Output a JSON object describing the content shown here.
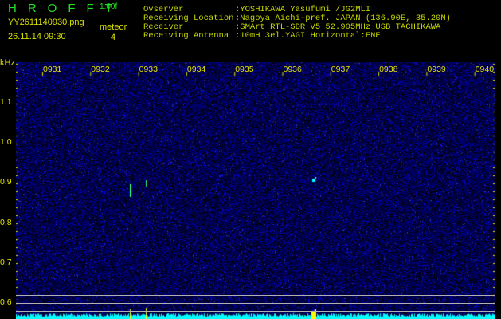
{
  "header": {
    "app": "HROFFT",
    "version": "1.00f",
    "filename": "YY2611140930.png",
    "datetime": "26.11.14 09:30",
    "meteor_label": "meteor",
    "meteor_count": "4"
  },
  "info": {
    "observer_label": "Ovserver",
    "observer": ":YOSHIKAWA Yasufumi /JG2MLI",
    "location_label": "Receiving Location",
    "location": ":Nagoya Aichi-pref. JAPAN (136.90E, 35.20N)",
    "receiver_label": "Receiver",
    "receiver": ":SMArt RTL-SDR V5 52.905MHz USB TACHIKAWA",
    "antenna_label": "Receiving Antenna",
    "antenna": ":10mH 3el.YAGI Horizontal:ENE"
  },
  "axis": {
    "unit": "kHz",
    "freq_ticks": [
      "1.1",
      "1.0",
      "0.9",
      "0.8",
      "0.7",
      "0.6"
    ],
    "time_ticks": [
      "0931",
      "0932",
      "0933",
      "0934",
      "0935",
      "0936",
      "0937",
      "0938",
      "0939",
      "0940"
    ]
  },
  "colors": {
    "background": "#000000",
    "noise": "#1010a0",
    "signal": "#00ffff",
    "label": "#e0e000"
  }
}
